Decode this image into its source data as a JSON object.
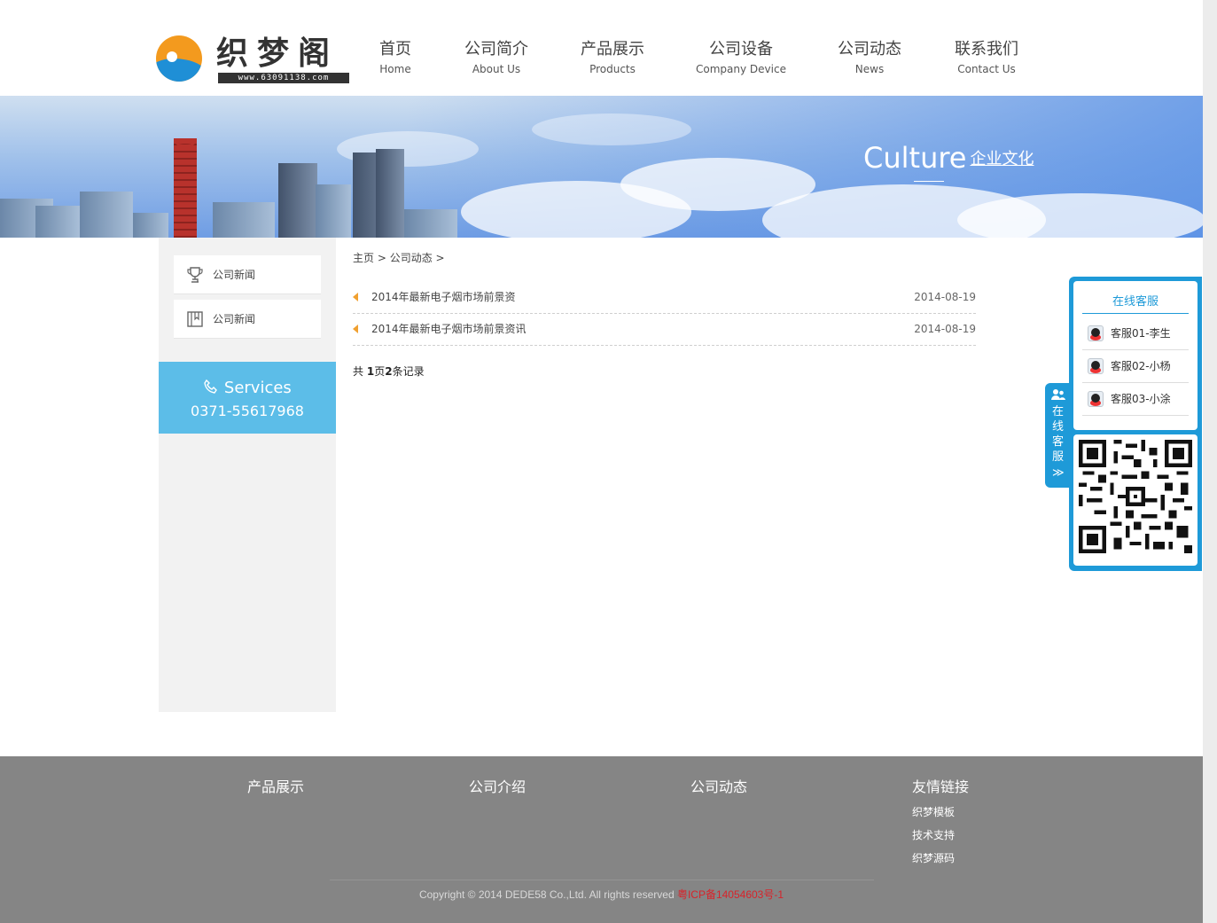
{
  "header": {
    "logo_text": "织梦阁",
    "logo_url": "www.63091138.com",
    "nav": [
      {
        "cn": "首页",
        "en": "Home"
      },
      {
        "cn": "公司简介",
        "en": "About Us"
      },
      {
        "cn": "产品展示",
        "en": "Products"
      },
      {
        "cn": "公司设备",
        "en": "Company Device"
      },
      {
        "cn": "公司动态",
        "en": "News"
      },
      {
        "cn": "联系我们",
        "en": "Contact Us"
      }
    ]
  },
  "banner": {
    "title": "Culture",
    "subtitle": "企业文化"
  },
  "sidebar": {
    "items": [
      {
        "label": "公司新闻",
        "icon": "trophy-icon"
      },
      {
        "label": "公司新闻",
        "icon": "book-icon"
      }
    ],
    "services": {
      "title": "Services",
      "phone": "0371-55617968",
      "icon": "phone-icon"
    }
  },
  "breadcrumb": {
    "home": "主页",
    "sep1": " > ",
    "section": "公司动态",
    "sep2": " >"
  },
  "articles": [
    {
      "title": "2014年最新电子烟市场前景资",
      "date": "2014-08-19"
    },
    {
      "title": "2014年最新电子烟市场前景资讯",
      "date": "2014-08-19"
    }
  ],
  "pager": {
    "prefix": "共 ",
    "pages": "1",
    "mid": "页",
    "records": "2",
    "suffix": "条记录"
  },
  "footer": {
    "columns": [
      {
        "heading": "产品展示",
        "links": []
      },
      {
        "heading": "公司介绍",
        "links": []
      },
      {
        "heading": "公司动态",
        "links": []
      },
      {
        "heading": "友情链接",
        "links": [
          "织梦模板",
          "技术支持",
          "织梦源码"
        ]
      }
    ],
    "copyright": "Copyright © 2014 DEDE58 Co.,Ltd. All rights reserved ",
    "icp": "粤ICP备14054603号-1"
  },
  "float_service": {
    "tab_label": "在线客服",
    "tab_arrow": "≫",
    "title": "在线客服",
    "agents": [
      "客服01-李生",
      "客服02-小杨",
      "客服03-小涂"
    ]
  },
  "colors": {
    "accent": "#1e9ad8",
    "services_bg": "#5cbde8",
    "footer_bg": "#858585",
    "icp_red": "#d8232a",
    "bullet_orange": "#f0a030"
  }
}
